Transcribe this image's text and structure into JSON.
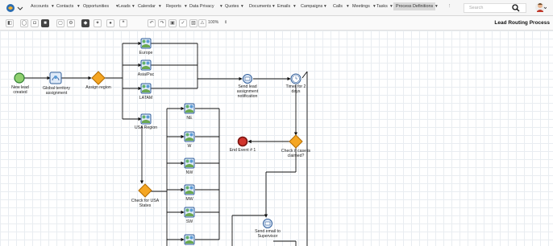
{
  "nav": {
    "items": [
      {
        "label": "Accounts",
        "active": false
      },
      {
        "label": "Contacts",
        "active": false
      },
      {
        "label": "Opportunities",
        "active": false
      },
      {
        "label": "Leads",
        "active": false
      },
      {
        "label": "Calendar",
        "active": false
      },
      {
        "label": "Reports",
        "active": false
      },
      {
        "label": "Data Privacy",
        "active": false
      },
      {
        "label": "Quotes",
        "active": false
      },
      {
        "label": "Documents",
        "active": false
      },
      {
        "label": "Emails",
        "active": false
      },
      {
        "label": "Campaigns",
        "active": false
      },
      {
        "label": "Calls",
        "active": false
      },
      {
        "label": "Meetings",
        "active": false
      },
      {
        "label": "Tasks",
        "active": false
      },
      {
        "label": "Process Definitions",
        "active": true
      }
    ],
    "more_label": "⋮",
    "search_placeholder": "Search"
  },
  "toolbar": {
    "zoom": "100%",
    "title": "Lead Routing Process"
  },
  "diagram": {
    "nodes": {
      "start": "New lead\ncreated",
      "global": "Global territory\nassignment",
      "assign": "Assign region",
      "europe": "Europe",
      "asiapac": "Asia/Pac",
      "latam": "LATAM",
      "usa": "USA Region",
      "ne": "NE",
      "w": "W",
      "nw": "NW",
      "mw": "MW",
      "sw": "SW",
      "checkusa": "Check for USA\nStates",
      "sendlead": "Send lead\nassignment\nnotification",
      "timer": "Timer for 2\ndays",
      "end": "End Event # 1",
      "checkclaimed": "Check if case is\nclaimed?",
      "sendemail": "Send email to\nSupervisor"
    }
  },
  "colors": {
    "task_fill": "#dfeaf8",
    "task_stroke": "#2f5d9a",
    "gateway_fill": "#f5a623",
    "start_fill": "#8fd06f",
    "end_fill": "#d0342c"
  }
}
